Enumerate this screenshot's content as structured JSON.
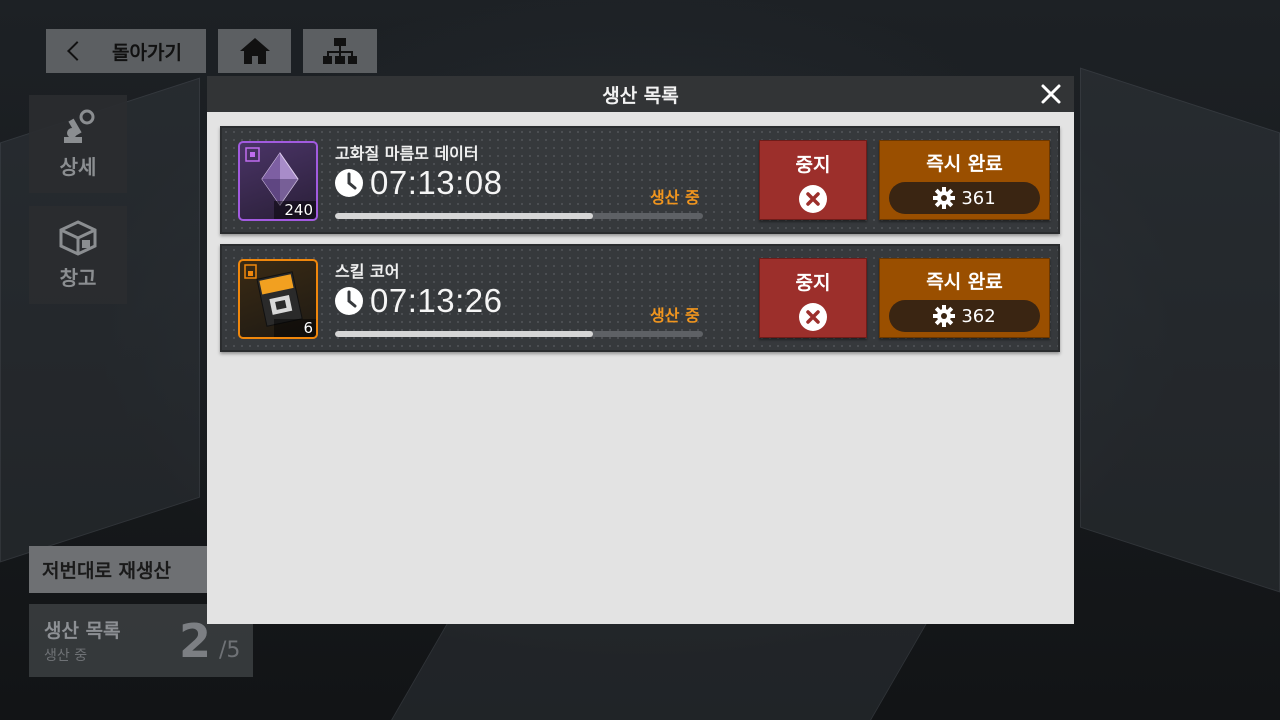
{
  "nav": {
    "back_label": "돌아가기",
    "home_icon": "home-icon",
    "map_icon": "hierarchy-icon"
  },
  "side": {
    "detail_label": "상세",
    "storage_label": "창고"
  },
  "reproduce_label": "저번대로 재생산",
  "queue": {
    "title": "생산 목록",
    "subtitle": "생산 중",
    "count": "2",
    "total": "/5"
  },
  "modal": {
    "title": "생산 목록",
    "items": [
      {
        "name": "고화질 마름모 데이터",
        "timer": "07:13:08",
        "status": "생산 중",
        "quantity": "240",
        "progress": 0.7,
        "stop_label": "중지",
        "instant_label": "즉시 완료",
        "cost": "361",
        "rarity_color": "#a25be0"
      },
      {
        "name": "스킬 코어",
        "timer": "07:13:26",
        "status": "생산 중",
        "quantity": "6",
        "progress": 0.7,
        "stop_label": "중지",
        "instant_label": "즉시 완료",
        "cost": "362",
        "rarity_color": "#f0870c"
      }
    ]
  },
  "colors": {
    "stop": "#9c2f2b",
    "instant": "#9a4f00",
    "status": "#f0951e"
  }
}
